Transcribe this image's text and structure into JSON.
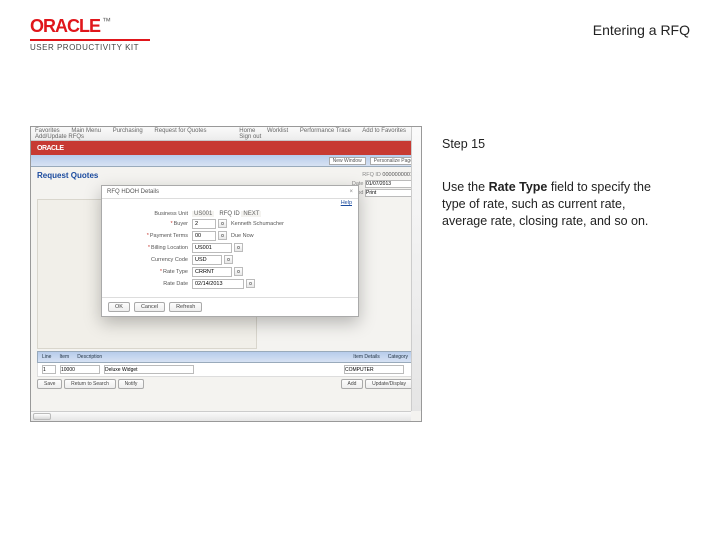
{
  "header": {
    "logo_word": "ORACLE",
    "logo_tm": "™",
    "logo_sub": "USER PRODUCTIVITY KIT",
    "title": "Entering a RFQ"
  },
  "instruction": {
    "step_label": "Step 15",
    "text_pre": "Use the ",
    "text_bold": "Rate Type",
    "text_post": " field to specify the type of rate, such as current rate, average rate, closing rate, and so on."
  },
  "app": {
    "topmenu": [
      "Favorites",
      "Main Menu",
      "Purchasing",
      "Request for Quotes",
      "Add/Update RFQs"
    ],
    "right_tabs": [
      "Home",
      "Worklist",
      "Performance Trace",
      "Add to Favorites",
      "Sign out"
    ],
    "brand": "ORACLE",
    "subnav": {
      "new_window": "New Window",
      "personalize": "Personalize Page"
    },
    "page_title": "Request Quotes",
    "right_info": {
      "line1_label": "RFQ ID",
      "line1_value": "0000000001",
      "line2_label": "Date",
      "line2_value": "01/07/2013",
      "line3_label": "Dispatch Method",
      "line3_value": "Print"
    }
  },
  "dialog": {
    "title": "RFQ HDOH Details",
    "help": "Help",
    "fields": {
      "bu_label": "Business Unit",
      "bu_value": "US001",
      "rfqid_label": "RFQ ID",
      "rfqid_value": "NEXT",
      "buyer_label": "Buyer",
      "buyer_value": "2",
      "buyer_name": "Kenneth Schumacher",
      "pay_label": "Payment Terms",
      "pay_value": "00",
      "pay_trail": "Due Now",
      "bill_label": "Billing Location",
      "bill_value": "US001",
      "curr_label": "Currency Code",
      "curr_value": "USD",
      "rate_label": "Rate Type",
      "rate_value": "CRRNT",
      "ratedate_label": "Rate Date",
      "ratedate_value": "02/14/2013"
    },
    "buttons": {
      "ok": "OK",
      "cancel": "Cancel",
      "refresh": "Refresh"
    }
  },
  "grid": {
    "cols": [
      "Line",
      "Item",
      "Description"
    ],
    "line_val": "1",
    "item_val": "10000",
    "desc_val": "Deluxe Widget",
    "more_label": "Item Details",
    "cat_label": "Category",
    "cat_val": "COMPUTER"
  },
  "footer": {
    "save": "Save",
    "return": "Return to Search",
    "notify": "Notify",
    "add": "Add",
    "update": "Update/Display"
  }
}
